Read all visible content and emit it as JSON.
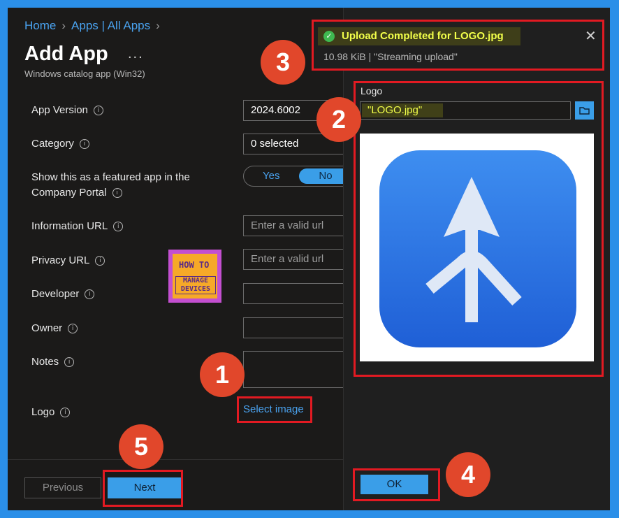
{
  "breadcrumb": {
    "home": "Home",
    "apps": "Apps | All Apps"
  },
  "page": {
    "title": "Add App",
    "more": "...",
    "subtitle": "Windows catalog app (Win32)"
  },
  "form": {
    "app_version_label": "App Version",
    "app_version_value": "2024.6002",
    "category_label": "Category",
    "category_value": "0 selected",
    "featured_label_line1": "Show this as a featured app in the",
    "featured_label_line2": "Company Portal",
    "featured_yes": "Yes",
    "featured_no": "No",
    "featured_selected": "No",
    "info_url_label": "Information URL",
    "info_url_placeholder": "Enter a valid url",
    "privacy_url_label": "Privacy URL",
    "privacy_url_placeholder": "Enter a valid url",
    "developer_label": "Developer",
    "owner_label": "Owner",
    "notes_label": "Notes",
    "logo_label": "Logo",
    "select_image": "Select image"
  },
  "footer": {
    "previous": "Previous",
    "next": "Next"
  },
  "watermark": {
    "line1": "HOW TO",
    "line2": "MANAGE DEVICES"
  },
  "toast": {
    "message": "Upload Completed for LOGO.jpg",
    "detail": "10.98 KiB | \"Streaming upload\"",
    "close": "✕"
  },
  "logo_panel": {
    "label": "Logo",
    "file_name": "\"LOGO.jpg\"",
    "ok": "OK"
  },
  "steps": [
    "1",
    "2",
    "3",
    "4",
    "5"
  ],
  "colors": {
    "accent": "#3a9ee8",
    "callout": "#e1472b",
    "highlight_box": "#e21a22",
    "toast_text": "#f2ff4a"
  }
}
